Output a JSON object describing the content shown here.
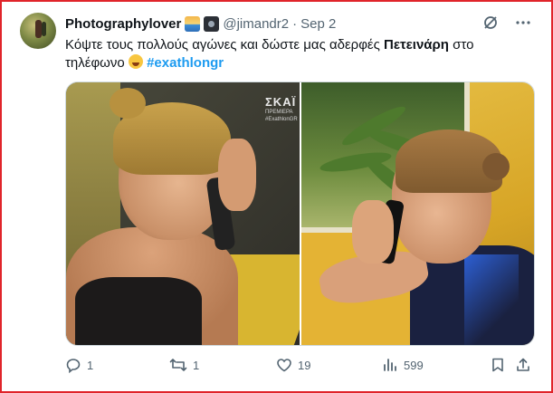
{
  "tweet": {
    "author_name": "Photographylover",
    "author_emojis": [
      "sunrise-emoji",
      "camera-emoji"
    ],
    "handle": "@jimandr2",
    "separator": "·",
    "date": "Sep 2",
    "text_part1": "Κόψτε τους πολλούς αγώνες και δώστε μας αδερφές ",
    "text_bold": "Πετεινάρη",
    "text_part2": " στο τηλέφωνο",
    "text_emoji": "laughing-emoji",
    "hashtag": "#exathlongr",
    "media": {
      "channel_logo": "ΣΚΑΪ",
      "channel_sub1": "ΠΡΕΜΙΕΡΑ",
      "channel_sub2": "#ExathlonGR"
    }
  },
  "actions": {
    "reply_count": "1",
    "retweet_count": "1",
    "like_count": "19",
    "views_count": "599"
  },
  "icons": {
    "grok": "grok-icon",
    "more": "more-icon",
    "reply": "reply-icon",
    "retweet": "retweet-icon",
    "like": "heart-icon",
    "views": "views-icon",
    "bookmark": "bookmark-icon",
    "share": "share-icon"
  },
  "colors": {
    "border": "#e0242a",
    "hashtag": "#1d9bf0",
    "muted": "#536471",
    "text": "#0f1419"
  }
}
